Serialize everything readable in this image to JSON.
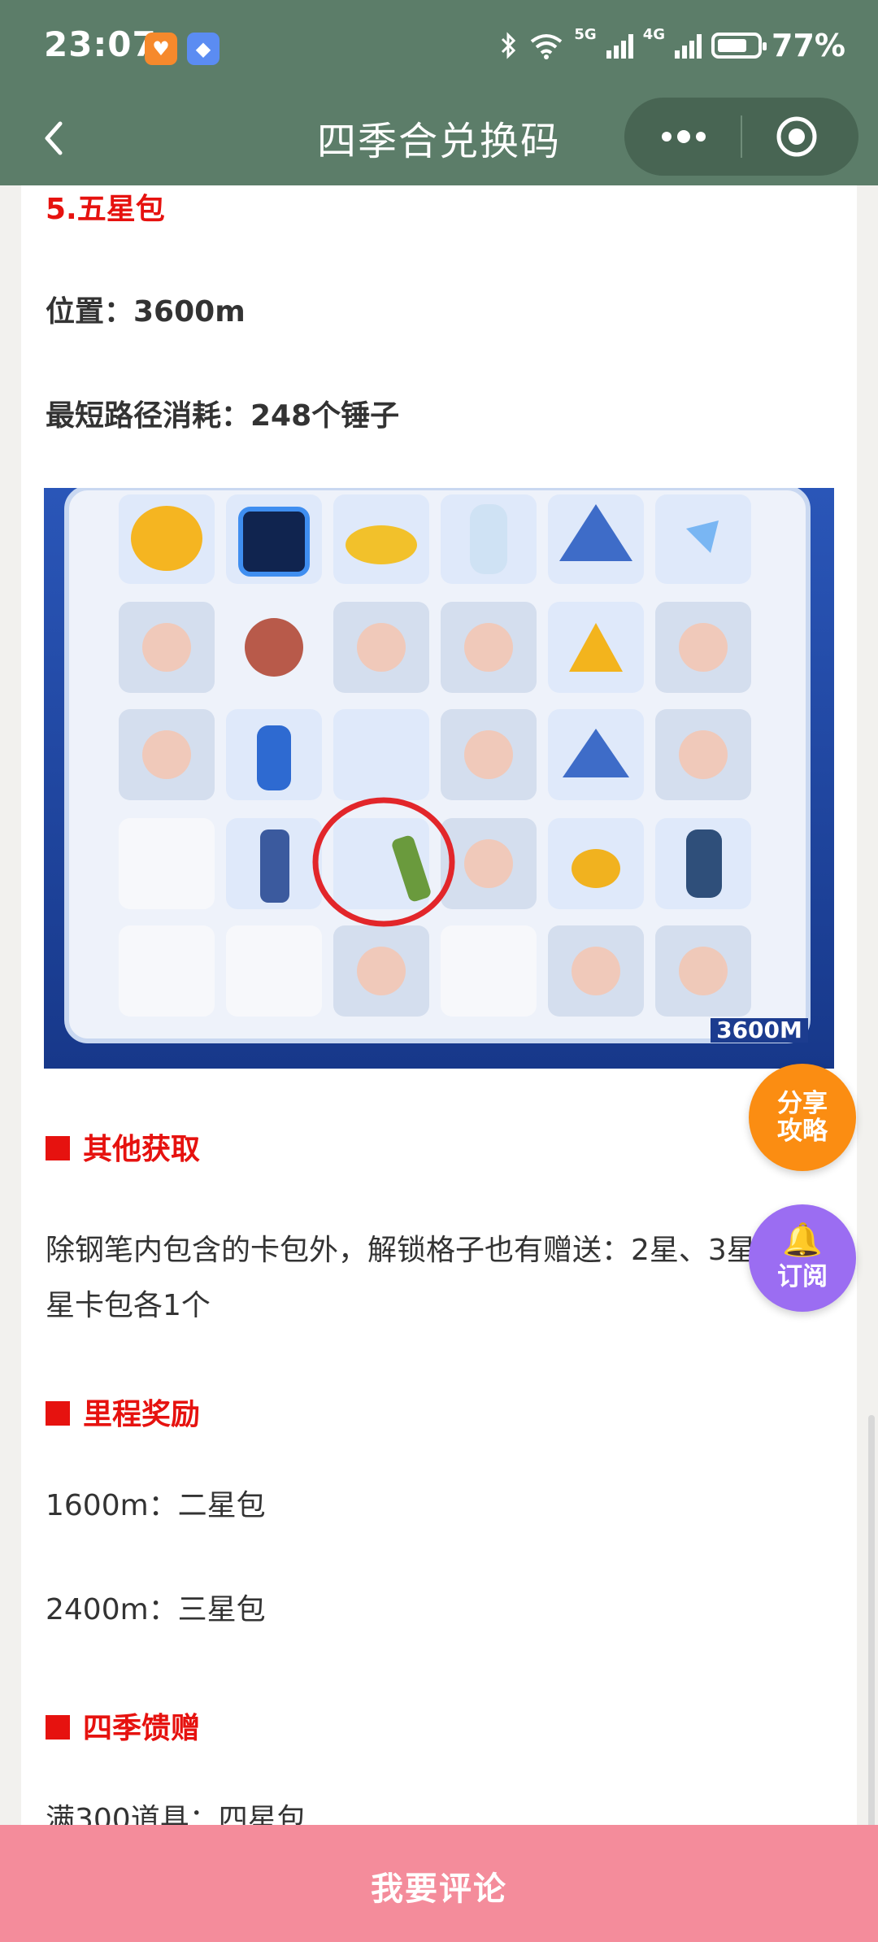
{
  "status_bar": {
    "time": "23:07",
    "net1": "5G",
    "net2": "4G",
    "battery": "77%",
    "battery_level": 0.77,
    "icons": [
      "orange-app-icon",
      "blue-app-icon",
      "bluetooth-icon",
      "wifi-icon",
      "signal-icon",
      "battery-icon"
    ]
  },
  "nav": {
    "title": "四季合兑换码",
    "icons": [
      "back-arrow-icon",
      "more-dots-icon",
      "target-close-icon"
    ]
  },
  "article": {
    "section_title": "5.五星包",
    "location": "位置：3600m",
    "min_cost": "最短路径消耗：248个锤子",
    "image_label": "3600M",
    "other_header": "其他获取",
    "other_text": "除钢笔内包含的卡包外，解锁格子也有赠送：2星、3星、4星卡包各1个",
    "mileage_header": "里程奖励",
    "mileage_1600": "1600m：二星包",
    "mileage_2400": "2400m：三星包",
    "gift_header": "四季馈赠",
    "gift_text": "满300道具：四星包"
  },
  "fabs": {
    "share_1": "分享",
    "share_2": "攻略",
    "subscribe": "订阅"
  },
  "bottom_bar": {
    "comment": "我要评论"
  },
  "colors": {
    "topbar": "#5c7d69",
    "red": "#e6120f",
    "share_fab": "#fb8d12",
    "subscribe_fab": "#9b6df2",
    "bottom_bar": "#f48c9b"
  }
}
